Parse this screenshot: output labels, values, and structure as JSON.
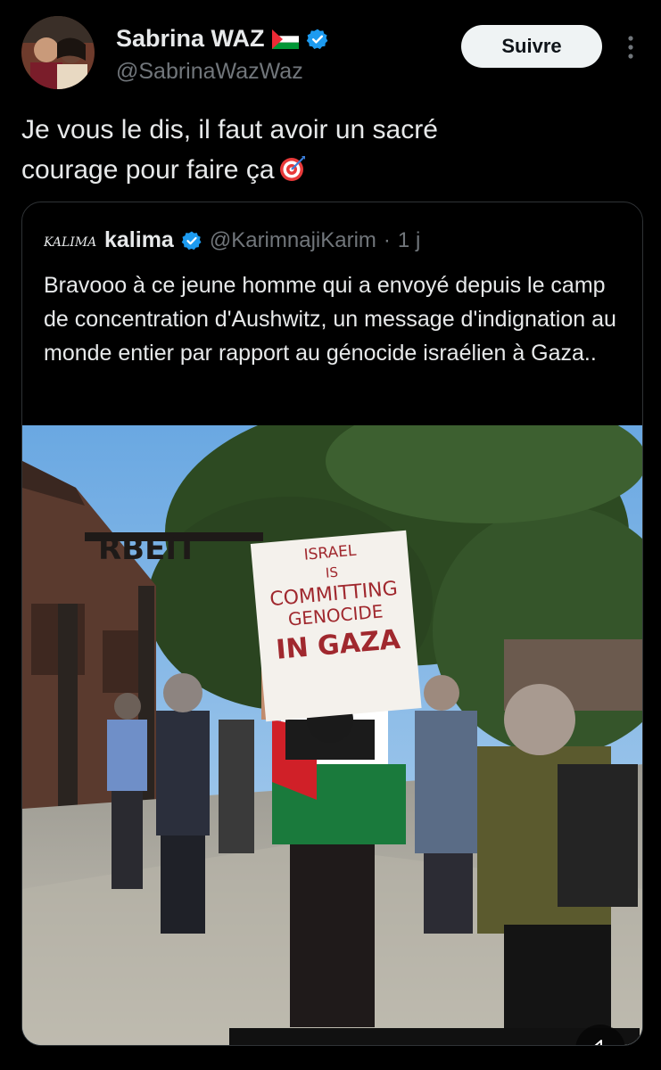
{
  "author": {
    "display_name": "Sabrina WAZ",
    "handle": "@SabrinaWazWaz",
    "verified": true,
    "flag_icon": "palestine-flag-icon"
  },
  "follow_label": "Suivre",
  "tweet": {
    "line1": "Je vous le dis, il faut avoir un sacré",
    "line2": "courage pour faire ça",
    "emoji": "direct-hit-target-icon"
  },
  "quoted": {
    "logo_text": "KALIMA",
    "display_name": "kalima",
    "handle": "@KarimnajiKarim",
    "separator": "·",
    "time": "1 j",
    "text": "Bravooo à ce jeune homme qui a envoyé depuis le camp de concentration d'Aushwitz, un message d'indignation au monde entier par rapport au génocide israélien à Gaza..",
    "media": {
      "sign_text": [
        "ISRAEL",
        "IS",
        "COMMITTING",
        "GENOCIDE",
        "IN GAZA"
      ],
      "gate_text": "RBEIT",
      "mute_icon": "volume-muted-icon"
    }
  },
  "colors": {
    "background": "#000000",
    "text": "#e7e9ea",
    "secondary": "#71767b",
    "verified": "#1d9bf0",
    "button_bg": "#eff3f4",
    "border": "#2f3336"
  }
}
